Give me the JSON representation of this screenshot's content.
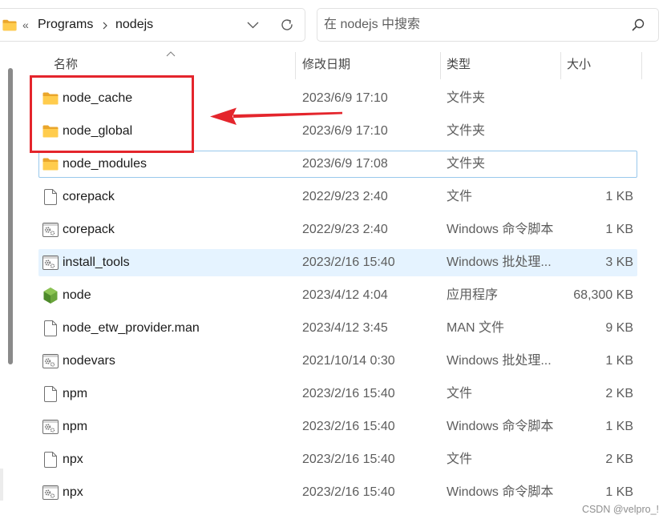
{
  "address_bar": {
    "location_icon": "folder-icon",
    "overflow_label": "«",
    "breadcrumbs": [
      "Programs",
      "nodejs"
    ],
    "separator_icon": "chevron-right-icon",
    "history_icon": "chevron-down-icon",
    "refresh_icon": "refresh-icon"
  },
  "search": {
    "placeholder": "在 nodejs 中搜索",
    "icon": "search-icon"
  },
  "columns": {
    "name": "名称",
    "date": "修改日期",
    "type": "类型",
    "size": "大小",
    "sort_icon": "chevron-up-icon"
  },
  "files": [
    {
      "name": "node_cache",
      "date": "2023/6/9 17:10",
      "type": "文件夹",
      "icon": "folder-icon"
    },
    {
      "name": "node_global",
      "date": "2023/6/9 17:10",
      "type": "文件夹",
      "icon": "folder-icon"
    },
    {
      "name": "node_modules",
      "date": "2023/6/9 17:08",
      "type": "文件夹",
      "icon": "folder-icon",
      "focused": true
    },
    {
      "name": "corepack",
      "date": "2022/9/23 2:40",
      "type": "文件",
      "size": "1 KB",
      "icon": "file-icon"
    },
    {
      "name": "corepack",
      "date": "2022/9/23 2:40",
      "type": "Windows 命令脚本",
      "size": "1 KB",
      "icon": "script-file-icon"
    },
    {
      "name": "install_tools",
      "date": "2023/2/16 15:40",
      "type": "Windows 批处理...",
      "size": "3 KB",
      "icon": "script-file-icon",
      "hovered": true
    },
    {
      "name": "node",
      "date": "2023/4/12 4:04",
      "type": "应用程序",
      "size": "68,300 KB",
      "icon": "nodejs-icon"
    },
    {
      "name": "node_etw_provider.man",
      "date": "2023/4/12 3:45",
      "type": "MAN 文件",
      "size": "9 KB",
      "icon": "file-icon"
    },
    {
      "name": "nodevars",
      "date": "2021/10/14 0:30",
      "type": "Windows 批处理...",
      "size": "1 KB",
      "icon": "script-file-icon"
    },
    {
      "name": "npm",
      "date": "2023/2/16 15:40",
      "type": "文件",
      "size": "2 KB",
      "icon": "file-icon"
    },
    {
      "name": "npm",
      "date": "2023/2/16 15:40",
      "type": "Windows 命令脚本",
      "size": "1 KB",
      "icon": "script-file-icon"
    },
    {
      "name": "npx",
      "date": "2023/2/16 15:40",
      "type": "文件",
      "size": "2 KB",
      "icon": "file-icon"
    },
    {
      "name": "npx",
      "date": "2023/2/16 15:40",
      "type": "Windows 命令脚本",
      "size": "1 KB",
      "icon": "script-file-icon"
    }
  ],
  "watermark": "CSDN @velpro_!",
  "colors": {
    "hover_row": "#e5f3ff",
    "focus_outline": "#99c8ec",
    "annotation": "#e4252c",
    "folder_front": "#ffcc4d",
    "folder_back": "#eaa62b",
    "nodejs_green": "#6aa53c"
  }
}
